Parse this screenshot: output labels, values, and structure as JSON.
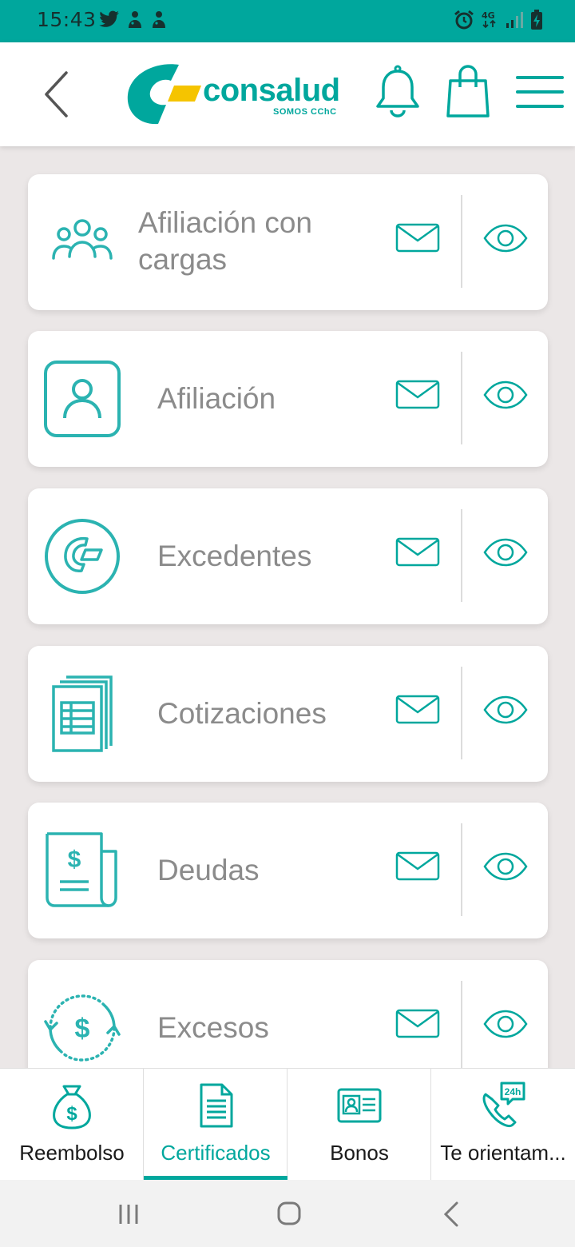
{
  "status_bar": {
    "time": "15:43",
    "icons_left": [
      "twitter-icon",
      "notification-icon",
      "notification-icon"
    ],
    "icons_right": [
      "alarm-icon",
      "4g-signal-icon",
      "signal-icon",
      "battery-charging-icon"
    ],
    "network": "4G"
  },
  "header": {
    "brand": "consalud",
    "tagline": "SOMOS CChC",
    "icons": [
      "back-icon",
      "bell-icon",
      "shopping-bag-icon",
      "hamburger-menu-icon"
    ]
  },
  "certificates": [
    {
      "label": "Afiliación con cargas",
      "icon": "group-icon"
    },
    {
      "label": "Afiliación",
      "icon": "user-profile-icon"
    },
    {
      "label": "Excedentes",
      "icon": "consalud-logo-circle-icon"
    },
    {
      "label": "Cotizaciones",
      "icon": "document-table-icon"
    },
    {
      "label": "Deudas",
      "icon": "money-document-icon"
    },
    {
      "label": "Excesos",
      "icon": "money-cycle-icon"
    }
  ],
  "row_actions": {
    "send": "mail-icon",
    "view": "eye-icon"
  },
  "tabs": [
    {
      "label": "Reembolso",
      "icon": "money-bag-icon",
      "active": false
    },
    {
      "label": "Certificados",
      "icon": "document-icon",
      "active": true
    },
    {
      "label": "Bonos",
      "icon": "id-card-icon",
      "active": false
    },
    {
      "label": "Te orientam...",
      "icon": "phone-24h-icon",
      "active": false
    }
  ],
  "colors": {
    "accent": "#00a79d",
    "logo_yellow": "#f5c400",
    "label_gray": "#8b8b8b",
    "icon_teal": "#2bb3b1"
  }
}
